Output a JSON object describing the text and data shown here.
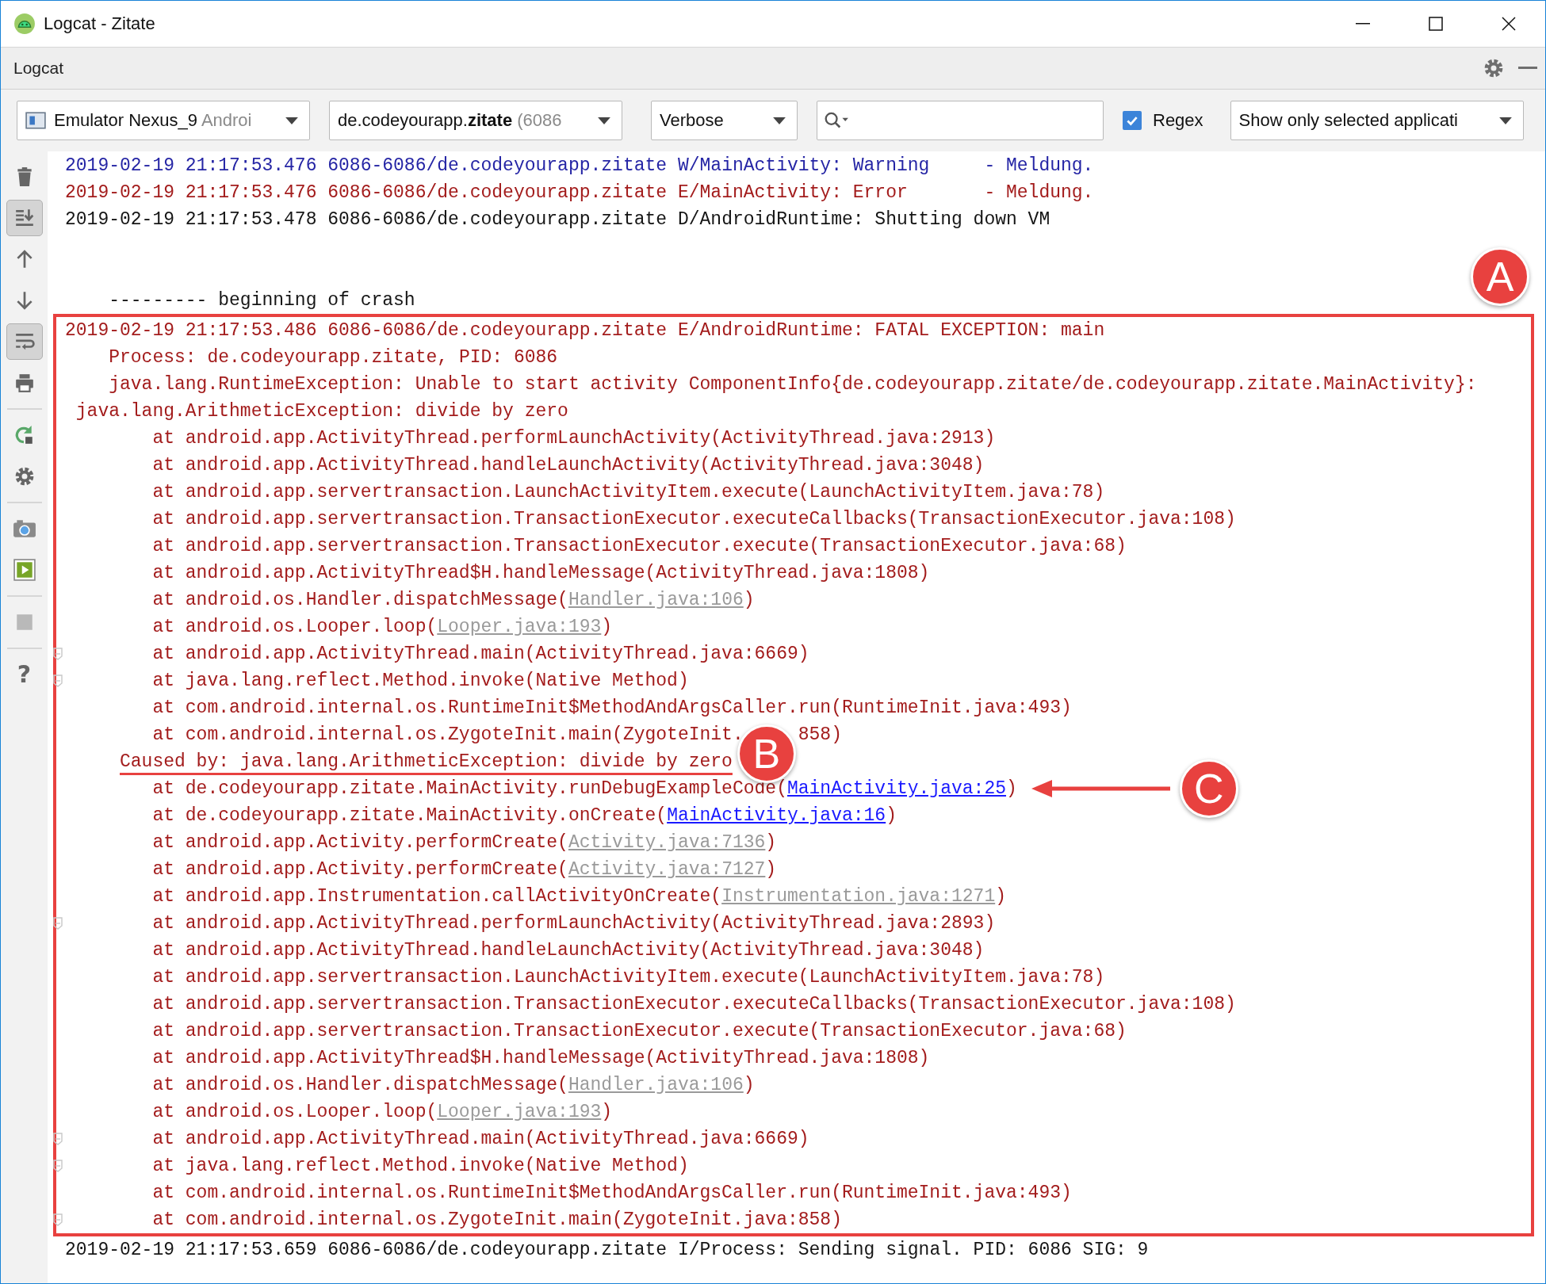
{
  "window": {
    "title": "Logcat - Zitate"
  },
  "tool_window": {
    "title": "Logcat"
  },
  "filters": {
    "device": {
      "name": "Emulator Nexus_9",
      "detail": "Androi"
    },
    "process": {
      "name": "de.codeyourapp.**zitate**",
      "detail": "(6086"
    },
    "log_level": "Verbose",
    "regex": {
      "label": "Regex",
      "checked": true
    },
    "filter_mode": "Show only selected applicati"
  },
  "toolbar": [
    {
      "kind": "delete",
      "pressed": false,
      "disabled": false
    },
    {
      "kind": "scroll-end",
      "pressed": true,
      "disabled": false
    },
    {
      "kind": "up",
      "pressed": false,
      "disabled": false
    },
    {
      "kind": "down",
      "pressed": false,
      "disabled": false
    },
    {
      "kind": "wrap",
      "pressed": true,
      "disabled": false
    },
    {
      "kind": "print",
      "pressed": false,
      "disabled": false
    },
    {
      "kind": "separator"
    },
    {
      "kind": "restart",
      "pressed": false,
      "disabled": false
    },
    {
      "kind": "settings",
      "pressed": false,
      "disabled": false
    },
    {
      "kind": "separator"
    },
    {
      "kind": "screenshot",
      "pressed": false,
      "disabled": false
    },
    {
      "kind": "record",
      "pressed": false,
      "disabled": false
    },
    {
      "kind": "separator"
    },
    {
      "kind": "stop",
      "pressed": false,
      "disabled": true
    },
    {
      "kind": "separator"
    },
    {
      "kind": "help",
      "glyph": "?",
      "pressed": false,
      "disabled": false
    }
  ],
  "log_before": [
    {
      "kind": "log",
      "color": "#2525a5",
      "text": "2019-02-19 21:17:53.476 6086-6086/de.codeyourapp.zitate W/MainActivity: Warning     - Meldung."
    },
    {
      "kind": "log",
      "color": "#a31c1c",
      "text": "2019-02-19 21:17:53.476 6086-6086/de.codeyourapp.zitate E/MainActivity: Error       - Meldung."
    },
    {
      "kind": "log",
      "color": "#151515",
      "text": "2019-02-19 21:17:53.478 6086-6086/de.codeyourapp.zitate D/AndroidRuntime: Shutting down VM"
    },
    {
      "kind": "blank"
    },
    {
      "kind": "blank"
    },
    {
      "kind": "separator",
      "text": "--------- beginning of crash"
    }
  ],
  "crash_box": {
    "badge": "A",
    "lines": [
      {
        "kind": "log",
        "color": "#a31c1c",
        "text": "2019-02-19 21:17:53.486 6086-6086/de.codeyourapp.zitate E/AndroidRuntime: FATAL EXCEPTION: main"
      },
      {
        "kind": "sub",
        "color": "#a31c1c",
        "text": "Process: de.codeyourapp.zitate, PID: 6086"
      },
      {
        "kind": "sub",
        "color": "#a31c1c",
        "text": "java.lang.RuntimeException: Unable to start activity ComponentInfo{de.codeyourapp.zitate/de.codeyourapp.zitate.MainActivity}:"
      },
      {
        "kind": "wrap",
        "color": "#a31c1c",
        "text": "java.lang.ArithmeticException: divide by zero"
      },
      {
        "kind": "frame",
        "color": "#a31c1c",
        "text": "at android.app.ActivityThread.performLaunchActivity(ActivityThread.java:2913)"
      },
      {
        "kind": "frame",
        "color": "#a31c1c",
        "text": "at android.app.ActivityThread.handleLaunchActivity(ActivityThread.java:3048)"
      },
      {
        "kind": "frame",
        "color": "#a31c1c",
        "text": "at android.app.servertransaction.LaunchActivityItem.execute(LaunchActivityItem.java:78)"
      },
      {
        "kind": "frame",
        "color": "#a31c1c",
        "text": "at android.app.servertransaction.TransactionExecutor.executeCallbacks(TransactionExecutor.java:108)"
      },
      {
        "kind": "frame",
        "color": "#a31c1c",
        "text": "at android.app.servertransaction.TransactionExecutor.execute(TransactionExecutor.java:68)"
      },
      {
        "kind": "frame",
        "color": "#a31c1c",
        "text": "at android.app.ActivityThread$H.handleMessage(ActivityThread.java:1808)"
      },
      {
        "kind": "frame",
        "color": "#a31c1c",
        "text": "at android.os.Handler.dispatchMessage(",
        "link": {
          "text": "Handler.java:106",
          "kind": "library"
        },
        "tail": ")"
      },
      {
        "kind": "frame",
        "color": "#a31c1c",
        "text": "at android.os.Looper.loop(",
        "link": {
          "text": "Looper.java:193",
          "kind": "library"
        },
        "tail": ")"
      },
      {
        "kind": "frame",
        "color": "#a31c1c",
        "text": "at android.app.ActivityThread.main(ActivityThread.java:6669)",
        "fold": true
      },
      {
        "kind": "frame",
        "color": "#a31c1c",
        "text": "at java.lang.reflect.Method.invoke(Native Method)",
        "fold": true
      },
      {
        "kind": "frame",
        "color": "#a31c1c",
        "text": "at com.android.internal.os.RuntimeInit$MethodAndArgsCaller.run(RuntimeInit.java:493)"
      },
      {
        "kind": "frame",
        "color": "#a31c1c",
        "text": "at com.android.internal.os.ZygoteInit.main(ZygoteInit.",
        "covered": true,
        "tail": "858)"
      },
      {
        "kind": "cause",
        "color": "#a31c1c",
        "text": "Caused by: java.lang.ArithmeticException: divide by zero",
        "badge": "B"
      },
      {
        "kind": "frame",
        "color": "#a31c1c",
        "text": "at de.codeyourapp.zitate.MainActivity.runDebugExampleCode(",
        "link": {
          "text": "MainActivity.java:25",
          "kind": "project"
        },
        "tail": ")",
        "callout": "C"
      },
      {
        "kind": "frame",
        "color": "#a31c1c",
        "text": "at de.codeyourapp.zitate.MainActivity.onCreate(",
        "link": {
          "text": "MainActivity.java:16",
          "kind": "project"
        },
        "tail": ")"
      },
      {
        "kind": "frame",
        "color": "#a31c1c",
        "text": "at android.app.Activity.performCreate(",
        "link": {
          "text": "Activity.java:7136",
          "kind": "library"
        },
        "tail": ")"
      },
      {
        "kind": "frame",
        "color": "#a31c1c",
        "text": "at android.app.Activity.performCreate(",
        "link": {
          "text": "Activity.java:7127",
          "kind": "library"
        },
        "tail": ")"
      },
      {
        "kind": "frame",
        "color": "#a31c1c",
        "text": "at android.app.Instrumentation.callActivityOnCreate(",
        "link": {
          "text": "Instrumentation.java:1271",
          "kind": "library"
        },
        "tail": ")"
      },
      {
        "kind": "frame",
        "color": "#a31c1c",
        "text": "at android.app.ActivityThread.performLaunchActivity(ActivityThread.java:2893)",
        "fold": true
      },
      {
        "kind": "frame",
        "color": "#a31c1c",
        "text": "at android.app.ActivityThread.handleLaunchActivity(ActivityThread.java:3048)"
      },
      {
        "kind": "frame",
        "color": "#a31c1c",
        "text": "at android.app.servertransaction.LaunchActivityItem.execute(LaunchActivityItem.java:78)"
      },
      {
        "kind": "frame",
        "color": "#a31c1c",
        "text": "at android.app.servertransaction.TransactionExecutor.executeCallbacks(TransactionExecutor.java:108)"
      },
      {
        "kind": "frame",
        "color": "#a31c1c",
        "text": "at android.app.servertransaction.TransactionExecutor.execute(TransactionExecutor.java:68)"
      },
      {
        "kind": "frame",
        "color": "#a31c1c",
        "text": "at android.app.ActivityThread$H.handleMessage(ActivityThread.java:1808)"
      },
      {
        "kind": "frame",
        "color": "#a31c1c",
        "text": "at android.os.Handler.dispatchMessage(",
        "link": {
          "text": "Handler.java:106",
          "kind": "library"
        },
        "tail": ")"
      },
      {
        "kind": "frame",
        "color": "#a31c1c",
        "text": "at android.os.Looper.loop(",
        "link": {
          "text": "Looper.java:193",
          "kind": "library"
        },
        "tail": ")"
      },
      {
        "kind": "frame",
        "color": "#a31c1c",
        "text": "at android.app.ActivityThread.main(ActivityThread.java:6669)",
        "fold": true
      },
      {
        "kind": "frame",
        "color": "#a31c1c",
        "text": "at java.lang.reflect.Method.invoke(Native Method)",
        "fold": true
      },
      {
        "kind": "frame",
        "color": "#a31c1c",
        "text": "at com.android.internal.os.RuntimeInit$MethodAndArgsCaller.run(RuntimeInit.java:493)"
      },
      {
        "kind": "frame",
        "color": "#a31c1c",
        "text": "at com.android.internal.os.ZygoteInit.main(ZygoteInit.java:858)",
        "fold": true
      }
    ]
  },
  "log_after": [
    {
      "kind": "log",
      "color": "#151515",
      "text": "2019-02-19 21:17:53.659 6086-6086/de.codeyourapp.zitate I/Process: Sending signal. PID: 6086 SIG: 9"
    }
  ]
}
